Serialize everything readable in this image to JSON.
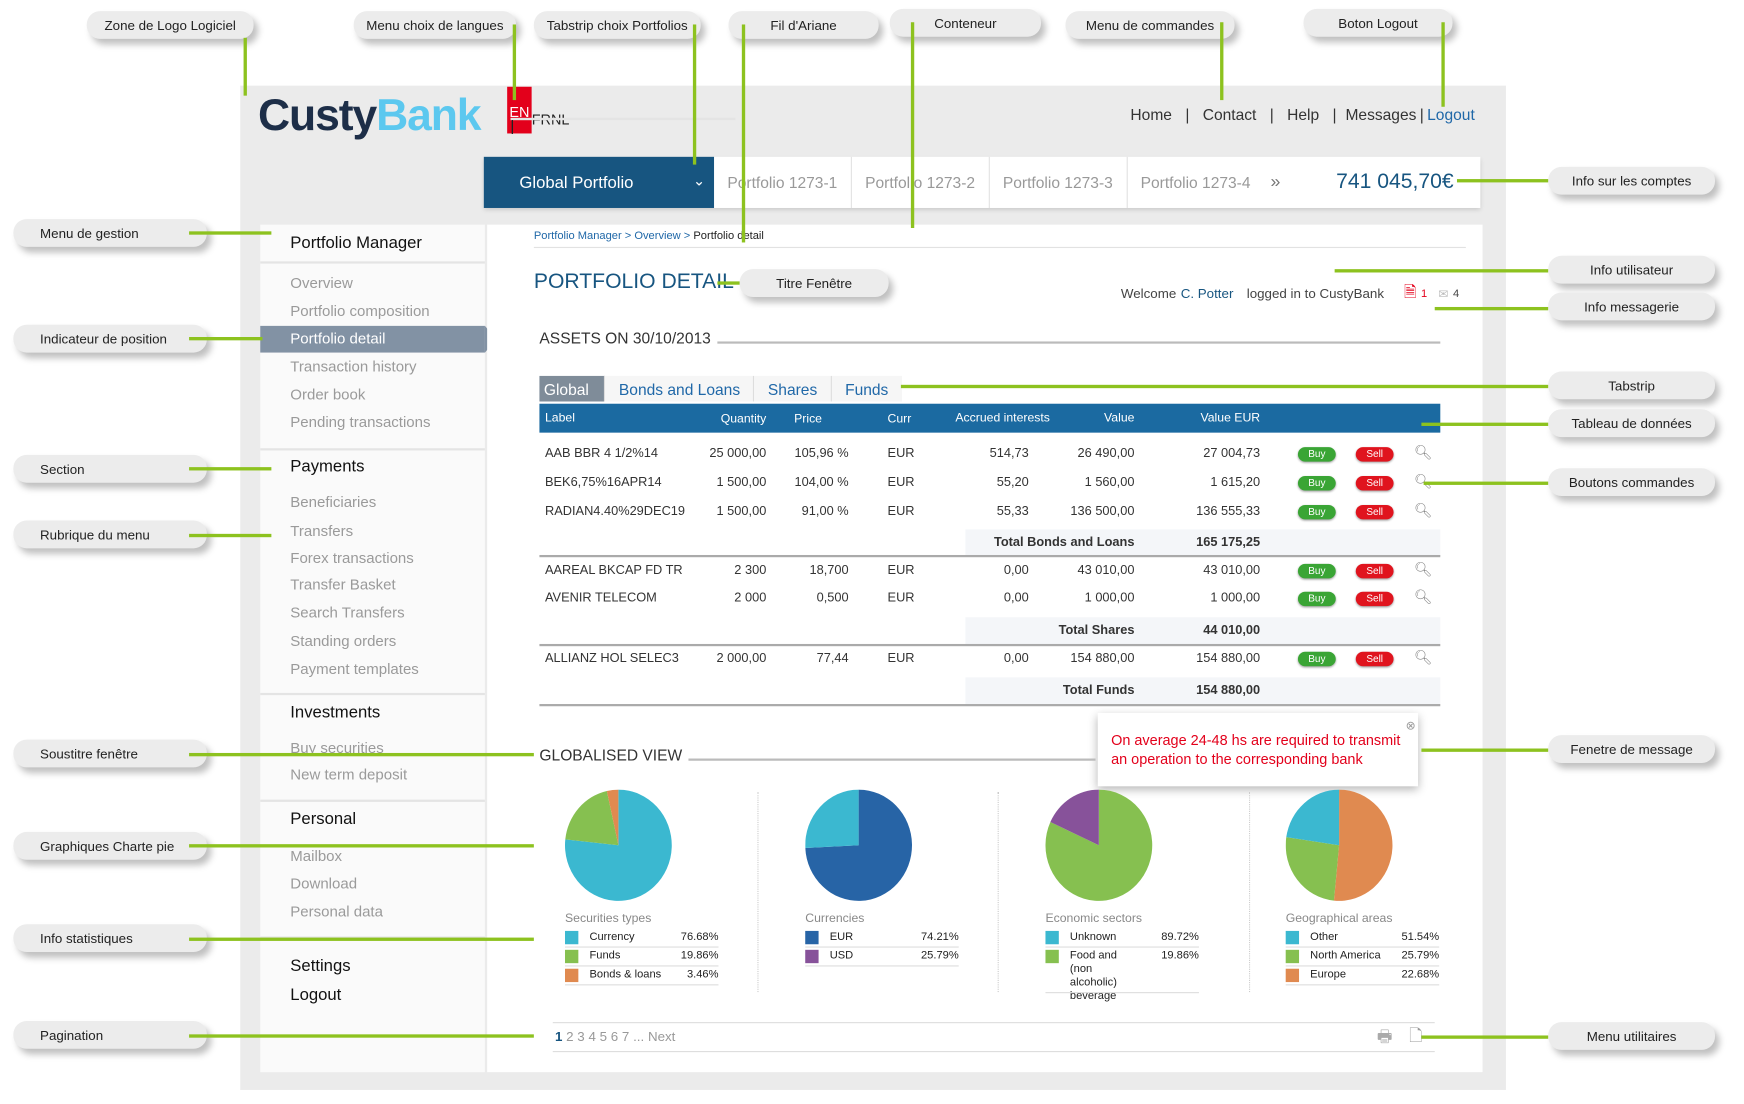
{
  "annotations": {
    "logo_zone": "Zone de Logo Logiciel",
    "lang_menu": "Menu choix de langues",
    "portfolio_tabstrip": "Tabstrip choix Portfolios",
    "breadcrumb": "Fil d'Ariane",
    "container": "Conteneur",
    "command_menu": "Menu de commandes",
    "logout_button": "Boton Logout",
    "account_info": "Info sur les comptes",
    "user_info": "Info utilisateur",
    "message_info": "Info messagerie",
    "tabstrip": "Tabstrip",
    "data_table": "Tableau de données",
    "command_buttons": "Boutons commandes",
    "message_window": "Fenetre de message",
    "utility_menu": "Menu utilitaires",
    "management_menu": "Menu de gestion",
    "position_indicator": "Indicateur de position",
    "section": "Section",
    "menu_item": "Rubrique du menu",
    "window_subtitle": "Soustitre fenêtre",
    "pie_charts": "Graphiques Charte pie",
    "statistics_info": "Info statistiques",
    "pagination": "Pagination"
  },
  "accent_color": "#8dc21f",
  "logo": {
    "part1": "Custy",
    "part2": "Bank"
  },
  "languages": {
    "active": "EN",
    "others": [
      "FR",
      "NL"
    ],
    "separator": "|"
  },
  "topnav": {
    "items": [
      "Home",
      "Contact",
      "Help",
      "Messages"
    ],
    "logout": "Logout",
    "separator": "|"
  },
  "portfolios": {
    "selected": "Global Portfolio",
    "tabs": [
      "Portfolio 1273-1",
      "Portfolio 1273-2",
      "Portfolio 1273-3",
      "Portfolio 1273-4"
    ],
    "more": "»",
    "total": "741 045,70€"
  },
  "sidebar": {
    "sections": [
      {
        "title": "Portfolio Manager",
        "items": [
          "Overview",
          "Portfolio composition",
          "Portfolio detail",
          "Transaction history",
          "Order book",
          "Pending transactions"
        ],
        "active": "Portfolio detail"
      },
      {
        "title": "Payments",
        "items": [
          "Beneficiaries",
          "Transfers",
          "Forex transactions",
          "Transfer Basket",
          "Search Transfers",
          "Standing orders",
          "Payment templates"
        ]
      },
      {
        "title": "Investments",
        "items": [
          "Buy securities",
          "New term deposit"
        ]
      },
      {
        "title": "Personal",
        "items": [
          "Mailbox",
          "Download",
          "Personal data"
        ]
      }
    ],
    "settings": "Settings",
    "logout": "Logout"
  },
  "breadcrumb": {
    "items": [
      "Portfolio Manager",
      "Overview"
    ],
    "current": "Portfolio detail",
    "separator": ">"
  },
  "page_title": "PORTFOLIO DETAIL",
  "user": {
    "welcome": "Welcome",
    "name": "C. Potter",
    "logged": "logged in to CustyBank",
    "doc_count": "1",
    "mail_count": "4"
  },
  "assets_title": "ASSETS ON 30/10/2013",
  "tabs": [
    "Global",
    "Bonds and Loans",
    "Shares",
    "Funds"
  ],
  "table": {
    "headers": [
      "Label",
      "Quantity",
      "Price",
      "Curr",
      "Accrued interests",
      "Value",
      "Value EUR"
    ],
    "buy": "Buy",
    "sell": "Sell",
    "groups": [
      {
        "rows": [
          [
            "AAB BBR 4 1/2%14",
            "25 000,00",
            "105,96 %",
            "EUR",
            "514,73",
            "26 490,00",
            "27 004,73"
          ],
          [
            "BEK6,75%16APR14",
            "1 500,00",
            "104,00 %",
            "EUR",
            "55,20",
            "1 560,00",
            "1 615,20"
          ],
          [
            "RADIAN4.40%29DEC19",
            "1 500,00",
            "91,00 %",
            "EUR",
            "55,33",
            "136 500,00",
            "136 555,33"
          ]
        ],
        "total_label": "Total Bonds and Loans",
        "total": "165 175,25"
      },
      {
        "rows": [
          [
            "AAREAL BKCAP FD TR",
            "2 300",
            "18,700",
            "EUR",
            "0,00",
            "43 010,00",
            "43 010,00"
          ],
          [
            "AVENIR TELECOM",
            "2 000",
            "0,500",
            "EUR",
            "0,00",
            "1 000,00",
            "1 000,00"
          ]
        ],
        "total_label": "Total Shares",
        "total": "44 010,00"
      },
      {
        "rows": [
          [
            "ALLIANZ HOL SELEC3",
            "2 000,00",
            "77,44",
            "EUR",
            "0,00",
            "154 880,00",
            "154 880,00"
          ]
        ],
        "total_label": "Total Funds",
        "total": "154 880,00"
      }
    ]
  },
  "message": {
    "text": "On average 24-48 hs are required to transmit an operation to the corresponding bank",
    "close": "⊗"
  },
  "globalised_title": "GLOBALISED VIEW",
  "chart_data": [
    {
      "type": "pie",
      "title": "Securities types",
      "slices": [
        {
          "label": "Currency",
          "value": 76.68,
          "color": "#3bb8d0",
          "swatch": "#3bb8d0"
        },
        {
          "label": "Funds",
          "value": 19.86,
          "color": "#86c050",
          "swatch": "#86c050"
        },
        {
          "label": "Bonds & loans",
          "value": 3.46,
          "color": "#e08a50",
          "swatch": "#e08a50"
        }
      ]
    },
    {
      "type": "pie",
      "title": "Currencies",
      "slices": [
        {
          "label": "EUR",
          "value": 74.21,
          "color": "#2764a6",
          "swatch": "#2764a6"
        },
        {
          "label": "USD",
          "value": 25.79,
          "color": "#3bb8d0",
          "swatch": "#87529a"
        }
      ]
    },
    {
      "type": "pie",
      "title": "Economic sectors",
      "slices": [
        {
          "label": "Unknown",
          "value": 89.72,
          "color": "#86c050",
          "swatch": "#3bb8d0"
        },
        {
          "label": "Food and (non alcoholic) beverage",
          "value": 19.86,
          "color": "#87529a",
          "swatch": "#86c050"
        }
      ]
    },
    {
      "type": "pie",
      "title": "Geographical areas",
      "slices": [
        {
          "label": "Other",
          "value": 51.54,
          "color": "#e08a50",
          "swatch": "#3bb8d0"
        },
        {
          "label": "North America",
          "value": 25.79,
          "color": "#86c050",
          "swatch": "#86c050"
        },
        {
          "label": "Europe",
          "value": 22.68,
          "color": "#3bb8d0",
          "swatch": "#e08a50"
        }
      ]
    }
  ],
  "pagination": {
    "current": "1",
    "pages": [
      "2",
      "3",
      "4",
      "5",
      "6",
      "7"
    ],
    "ellipsis": "...",
    "next": "Next"
  }
}
